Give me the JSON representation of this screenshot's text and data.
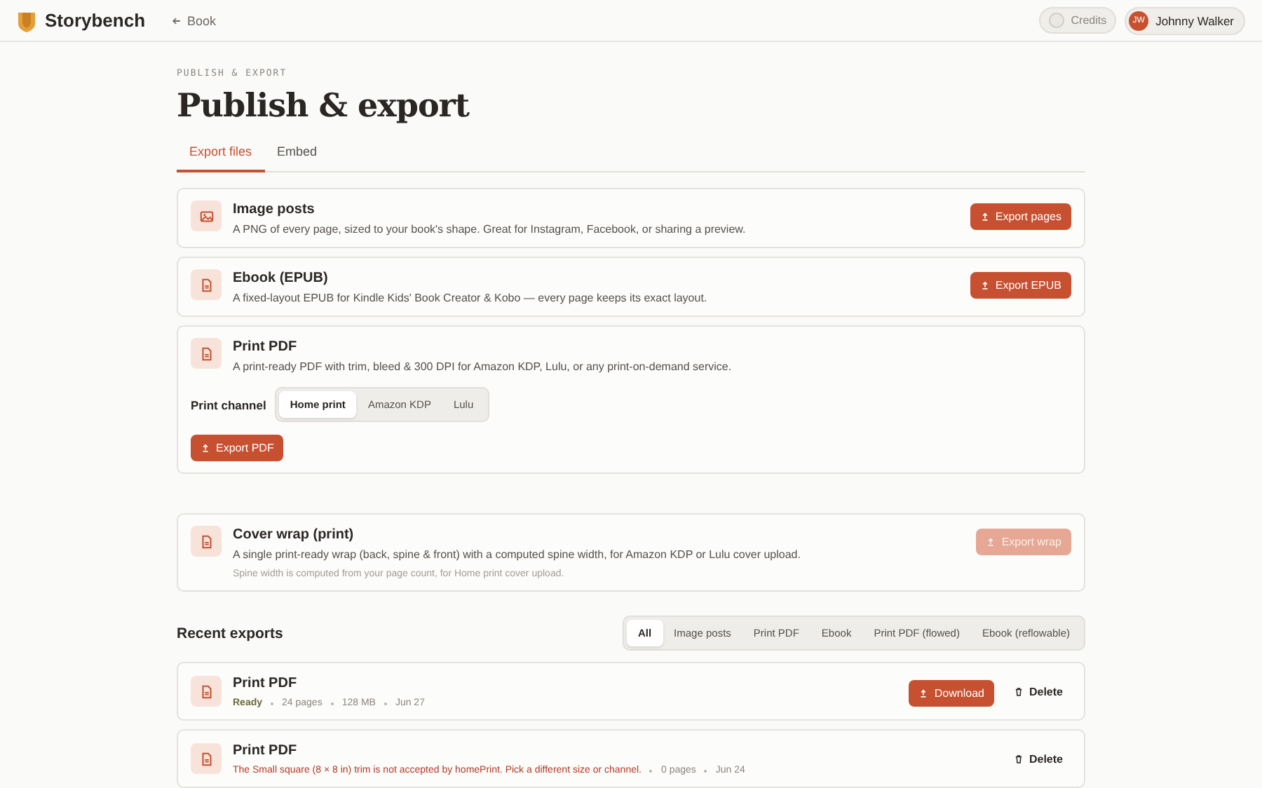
{
  "topbar": {
    "brand": "Storybench",
    "back_link": "Book",
    "credits": "Credits",
    "user": {
      "initials": "JW",
      "name": "Johnny Walker"
    }
  },
  "page": {
    "eyebrow": "PUBLISH & EXPORT",
    "title": "Publish & export"
  },
  "tabs": [
    {
      "label": "Export files",
      "selected": true
    },
    {
      "label": "Embed",
      "selected": false
    }
  ],
  "export_cards": [
    {
      "kind": "image",
      "title": "Image posts",
      "description": "A PNG of every page, sized to your book's shape. Great for Instagram, Facebook, or sharing a preview.",
      "button": {
        "label": "Export pages",
        "disabled": false
      }
    },
    {
      "kind": "document",
      "title": "Ebook (EPUB)",
      "description": "A fixed-layout EPUB for Kindle Kids' Book Creator & Kobo — every page keeps its exact layout.",
      "button": {
        "label": "Export EPUB",
        "disabled": false
      }
    },
    {
      "kind": "document",
      "title": "Print PDF",
      "description": "A print-ready PDF with trim, bleed & 300 DPI for Amazon KDP, Lulu, or any print-on-demand service.",
      "channel": {
        "label": "Print channel",
        "options": [
          {
            "label": "Home print",
            "selected": true
          },
          {
            "label": "Amazon KDP",
            "selected": false
          },
          {
            "label": "Lulu",
            "selected": false
          }
        ]
      },
      "button": {
        "label": "Export PDF",
        "disabled": false
      }
    }
  ],
  "cover_card": {
    "kind": "document",
    "title": "Cover wrap (print)",
    "description": "A single print-ready wrap (back, spine & front) with a computed spine width, for Amazon KDP or Lulu cover upload.",
    "note": "Spine width is computed from your page count, for Home print cover upload.",
    "button": {
      "label": "Export wrap",
      "disabled": true
    }
  },
  "recent": {
    "heading": "Recent exports",
    "filters": [
      {
        "label": "All",
        "selected": true
      },
      {
        "label": "Image posts",
        "selected": false
      },
      {
        "label": "Print PDF",
        "selected": false
      },
      {
        "label": "Ebook",
        "selected": false
      },
      {
        "label": "Print PDF (flowed)",
        "selected": false
      },
      {
        "label": "Ebook (reflowable)",
        "selected": false
      }
    ],
    "items": [
      {
        "title": "Print PDF",
        "status": {
          "kind": "ready",
          "text": "Ready"
        },
        "meta": [
          "24 pages",
          "128 MB",
          "Jun 27"
        ],
        "download": "Download",
        "delete": "Delete"
      },
      {
        "title": "Print PDF",
        "status": {
          "kind": "error",
          "text": "The Small square (8 × 8 in) trim is not accepted by homePrint. Pick a different size or channel."
        },
        "meta": [
          "0 pages",
          "Jun 24"
        ],
        "delete": "Delete"
      }
    ]
  }
}
